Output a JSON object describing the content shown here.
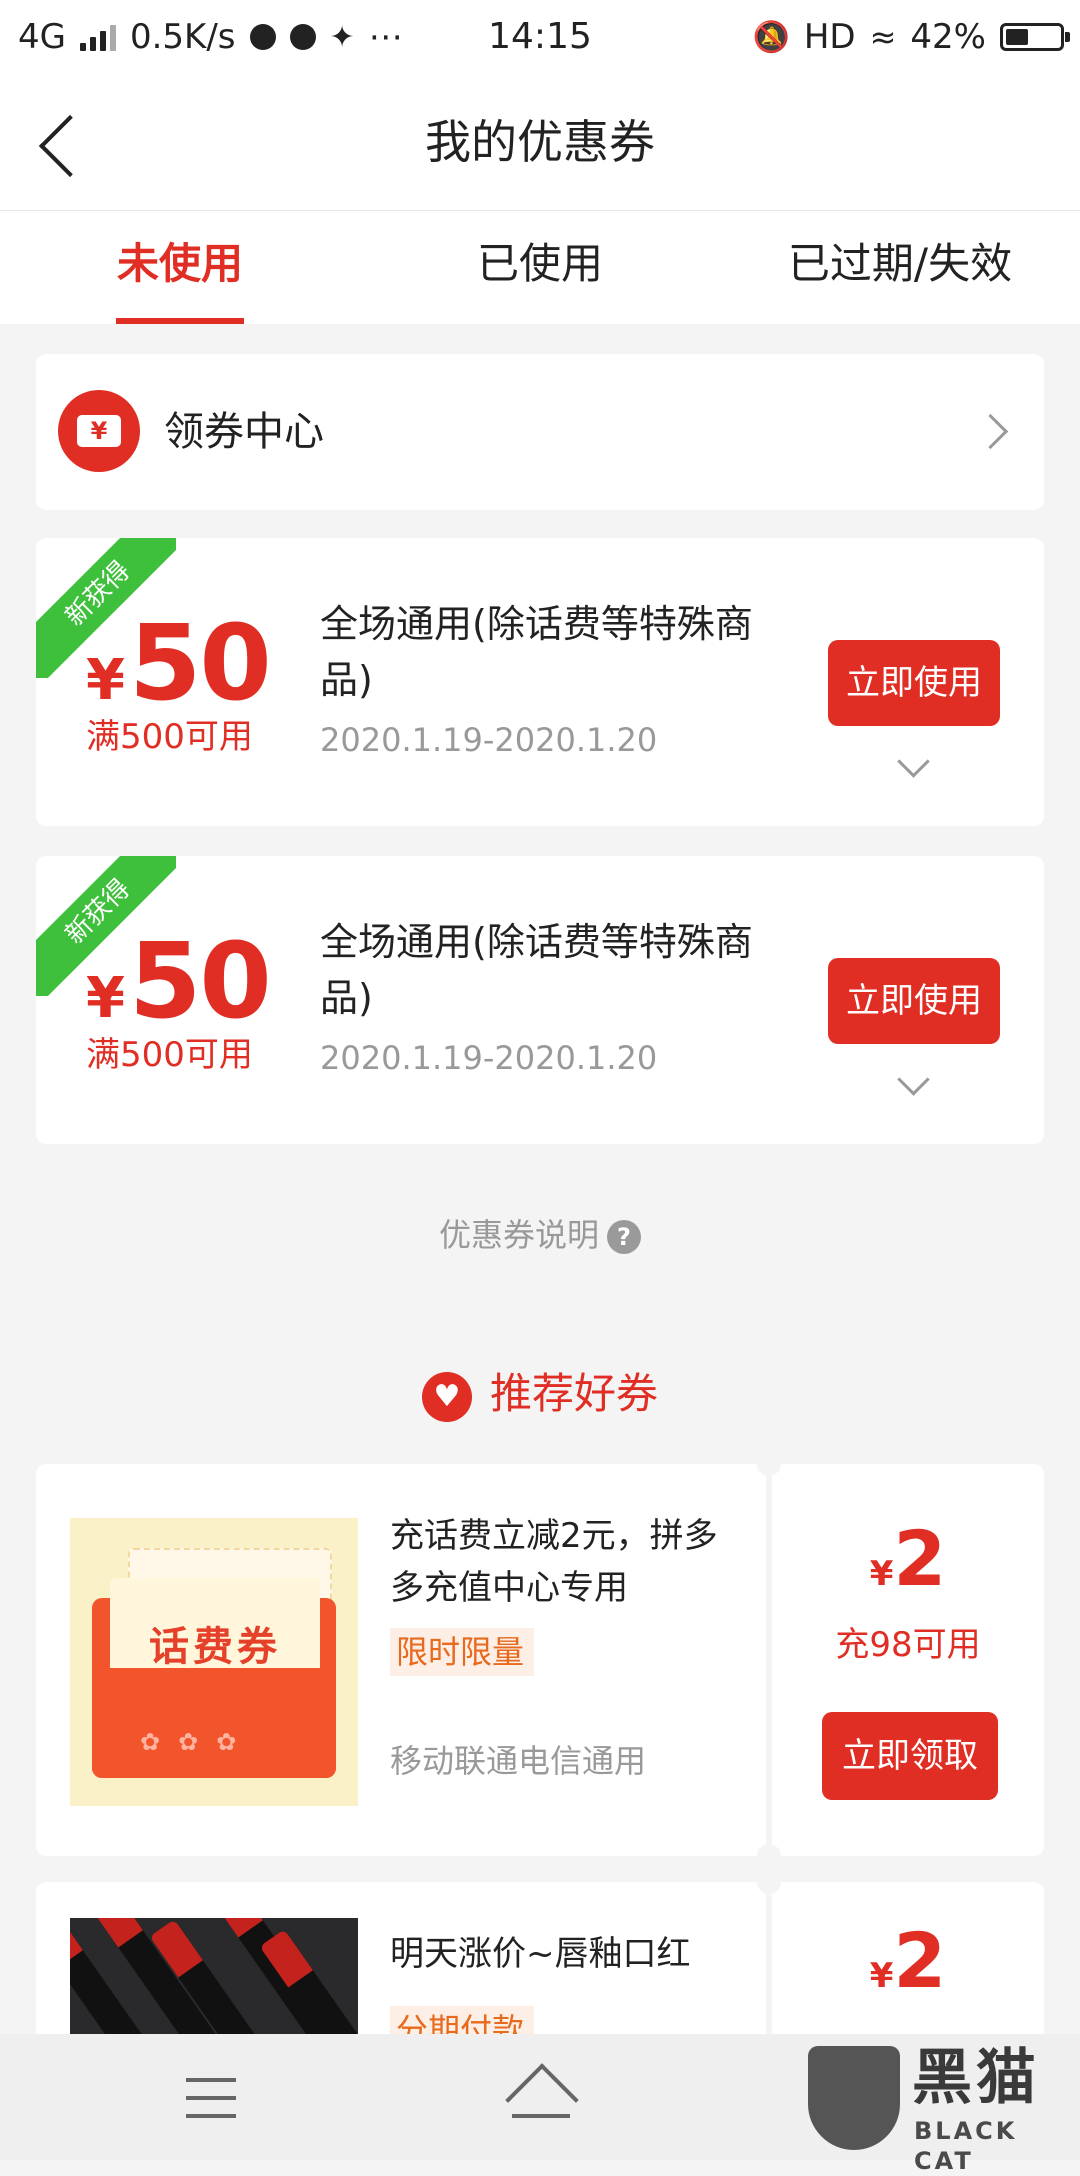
{
  "status_bar": {
    "network": "4G",
    "speed": "0.5K/s",
    "time": "14:15",
    "hd": "HD",
    "battery": "42%",
    "battery_level": 0.42
  },
  "nav": {
    "title": "我的优惠券"
  },
  "tabs": [
    {
      "label": "未使用",
      "active": true
    },
    {
      "label": "已使用",
      "active": false
    },
    {
      "label": "已过期/失效",
      "active": false
    }
  ],
  "coupon_center": {
    "label": "领券中心",
    "icon_char": "¥"
  },
  "coupons": [
    {
      "ribbon": "新获得",
      "currency": "¥",
      "amount": "50",
      "condition": "满500可用",
      "description": "全场通用(除话费等特殊商品)",
      "date_range": "2020.1.19-2020.1.20",
      "button": "立即使用"
    },
    {
      "ribbon": "新获得",
      "currency": "¥",
      "amount": "50",
      "condition": "满500可用",
      "description": "全场通用(除话费等特殊商品)",
      "date_range": "2020.1.19-2020.1.20",
      "button": "立即使用"
    }
  ],
  "explain": {
    "label": "优惠券说明",
    "icon_char": "?"
  },
  "recommend": {
    "heading": "推荐好券",
    "items": [
      {
        "image_text": "话费券",
        "title": "充话费立减2元，拼多多充值中心专用",
        "tag": "限时限量",
        "subtitle": "移动联通电信通用",
        "currency": "¥",
        "amount": "2",
        "condition": "充98可用",
        "button": "立即领取"
      },
      {
        "title": "明天涨价~唇釉口红",
        "tag": "分期付款",
        "currency": "¥",
        "amount": "2"
      }
    ]
  },
  "watermark": {
    "cn": "黑猫",
    "en": "BLACK CAT"
  },
  "colors": {
    "accent": "#e02e24",
    "ribbon": "#3fc03c",
    "tag": "#e86a1c"
  }
}
